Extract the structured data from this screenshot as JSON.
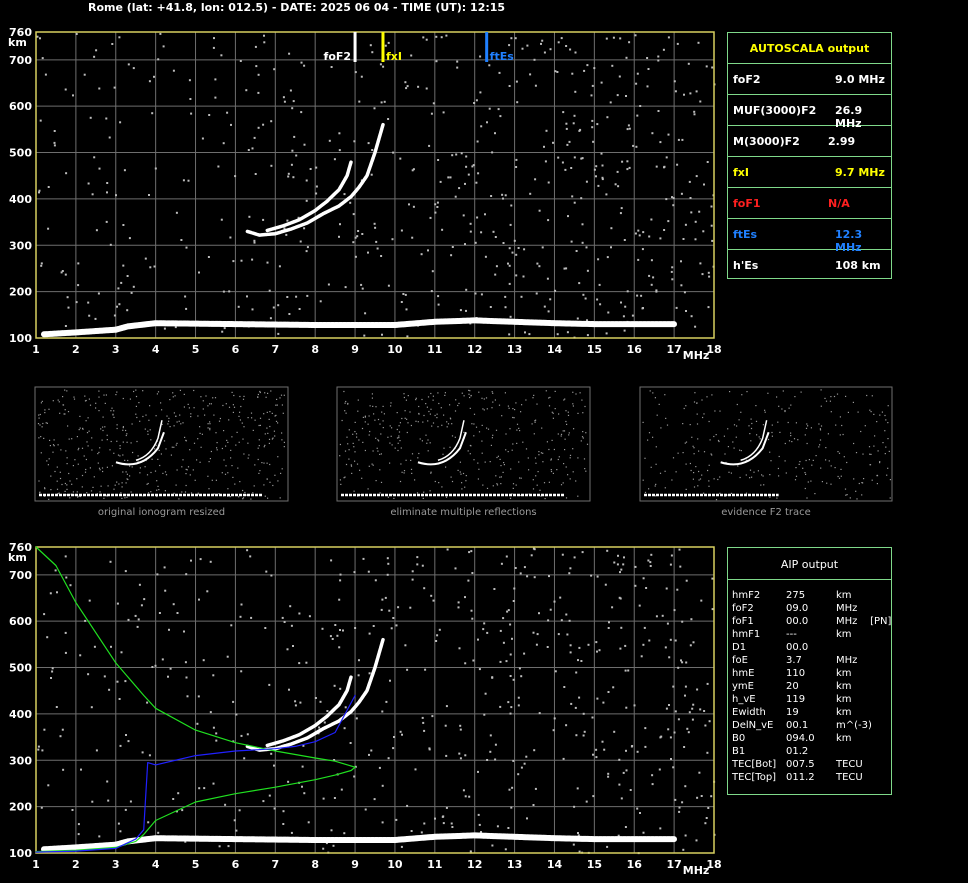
{
  "header": "Rome (lat: +41.8, lon: 012.5) - DATE: 2025 06 04 - TIME (UT): 12:15",
  "colors": {
    "grid": "#6e6e6e",
    "frame": "#d8d060",
    "green": "#7fd98a",
    "yellow": "#ffff00",
    "red": "#ff2020",
    "blue": "#2080ff",
    "trace": "#ffffff"
  },
  "chart_data": [
    {
      "type": "scatter",
      "title": "",
      "xlabel": "MHz",
      "ylabel": "km",
      "xlim": [
        1,
        18
      ],
      "ylim": [
        100,
        760
      ],
      "xticks": [
        "1",
        "2",
        "3",
        "4",
        "5",
        "6",
        "7",
        "8",
        "9",
        "10",
        "11",
        "12",
        "13",
        "14",
        "15",
        "16",
        "17",
        "18"
      ],
      "yticks": [
        "100",
        "200",
        "300",
        "400",
        "500",
        "600",
        "700",
        "760"
      ],
      "markers": [
        {
          "label": "foF2",
          "x": 9.0,
          "color": "#ffffff"
        },
        {
          "label": "fxI",
          "x": 9.7,
          "color": "#ffff00"
        },
        {
          "label": "ftEs",
          "x": 12.3,
          "color": "#2080ff"
        }
      ],
      "series": [
        {
          "x": [
            6.3,
            6.6,
            7.0,
            7.4,
            7.8,
            8.2,
            8.6,
            8.9,
            9.1,
            9.3,
            9.5,
            9.7
          ],
          "y": [
            330,
            322,
            325,
            335,
            348,
            368,
            385,
            405,
            425,
            450,
            500,
            560
          ]
        },
        {
          "x": [
            6.8,
            7.2,
            7.6,
            8.0,
            8.3,
            8.6,
            8.8,
            8.9
          ],
          "y": [
            332,
            342,
            355,
            375,
            395,
            420,
            450,
            480
          ]
        },
        {
          "x": [
            1.2,
            2.0,
            3.0,
            3.3,
            4.0,
            6.0,
            8.0,
            10.0,
            11.0,
            12.0,
            13.0,
            14.0,
            15.0,
            16.0,
            17.0
          ],
          "y": [
            108,
            112,
            118,
            125,
            132,
            130,
            128,
            128,
            135,
            138,
            135,
            132,
            130,
            130,
            130
          ]
        }
      ]
    },
    {
      "type": "line",
      "title": "",
      "xlabel": "MHz",
      "ylabel": "km",
      "xlim": [
        1,
        18
      ],
      "ylim": [
        100,
        760
      ],
      "xticks": [
        "1",
        "2",
        "3",
        "4",
        "5",
        "6",
        "7",
        "8",
        "9",
        "10",
        "11",
        "12",
        "13",
        "14",
        "15",
        "16",
        "17",
        "18"
      ],
      "yticks": [
        "100",
        "200",
        "300",
        "400",
        "500",
        "600",
        "700",
        "760"
      ],
      "series": [
        {
          "x": [
            6.3,
            6.6,
            7.0,
            7.4,
            7.8,
            8.2,
            8.6,
            8.9,
            9.1,
            9.3,
            9.5,
            9.7
          ],
          "y": [
            330,
            322,
            325,
            335,
            348,
            368,
            385,
            405,
            425,
            450,
            500,
            560
          ]
        },
        {
          "x": [
            6.8,
            7.2,
            7.6,
            8.0,
            8.3,
            8.6,
            8.8,
            8.9
          ],
          "y": [
            332,
            342,
            355,
            375,
            395,
            420,
            450,
            480
          ]
        },
        {
          "x": [
            1.2,
            2.0,
            3.0,
            3.3,
            4.0,
            6.0,
            8.0,
            10.0,
            11.0,
            12.0,
            13.0,
            14.0,
            15.0,
            16.0,
            17.0
          ],
          "y": [
            108,
            112,
            118,
            125,
            132,
            130,
            128,
            128,
            135,
            138,
            135,
            132,
            130,
            130,
            130
          ]
        },
        {
          "x": [
            1.0,
            1.5,
            2.0,
            3.0,
            3.7,
            4.0,
            5.0,
            6.0,
            7.0,
            8.0,
            8.5,
            9.0
          ],
          "y": [
            760,
            720,
            640,
            510,
            440,
            412,
            365,
            338,
            320,
            305,
            298,
            285
          ],
          "color": "#20e020"
        },
        {
          "x": [
            1.0,
            2.0,
            3.0,
            3.5,
            3.7,
            4.0,
            5.0,
            6.0,
            7.0,
            8.0,
            8.5,
            8.9,
            9.0
          ],
          "y": [
            103,
            106,
            112,
            125,
            140,
            170,
            210,
            228,
            242,
            258,
            268,
            278,
            285
          ],
          "color": "#20e020"
        },
        {
          "x": [
            1.0,
            2.0,
            3.0,
            3.5,
            3.7,
            3.8,
            4.0,
            5.0,
            6.0,
            7.0,
            7.5,
            8.0,
            8.5,
            9.0
          ],
          "y": [
            102,
            104,
            110,
            130,
            150,
            295,
            290,
            310,
            320,
            325,
            330,
            340,
            360,
            440
          ],
          "color": "#2020ff"
        }
      ]
    }
  ],
  "autoscala": {
    "title": "AUTOSCALA output",
    "rows": [
      {
        "label": "foF2",
        "value": "9.0 MHz",
        "color": "#ffffff"
      },
      {
        "label": "MUF(3000)F2",
        "value": "26.9 MHz",
        "color": "#ffffff"
      },
      {
        "label": "M(3000)F2",
        "value": "2.99",
        "color": "#ffffff"
      },
      {
        "label": "fxI",
        "value": "9.7 MHz",
        "color": "#ffff00"
      },
      {
        "label": "foF1",
        "value": "N/A",
        "color": "#ff2020"
      },
      {
        "label": "ftEs",
        "value": "12.3 MHz",
        "color": "#2080ff"
      },
      {
        "label": "h'Es",
        "value": "108    km",
        "color": "#ffffff"
      }
    ]
  },
  "thumbs": [
    {
      "caption": "original ionogram resized"
    },
    {
      "caption": "eliminate multiple reflections"
    },
    {
      "caption": "evidence F2 trace"
    }
  ],
  "aip": {
    "title": "AIP output",
    "rows": [
      {
        "name": "hmF2",
        "value": "275",
        "unit": "km"
      },
      {
        "name": "foF2",
        "value": "09.0",
        "unit": "MHz"
      },
      {
        "name": "foF1",
        "value": "00.0",
        "unit": "MHz    [PN]"
      },
      {
        "name": "hmF1",
        "value": "---",
        "unit": "km"
      },
      {
        "name": "D1",
        "value": "00.0",
        "unit": ""
      },
      {
        "name": "foE",
        "value": "3.7",
        "unit": "MHz"
      },
      {
        "name": "hmE",
        "value": "110",
        "unit": "km"
      },
      {
        "name": "ymE",
        "value": "20",
        "unit": "km"
      },
      {
        "name": "h_vE",
        "value": "119",
        "unit": "km"
      },
      {
        "name": "Ewidth",
        "value": "19",
        "unit": "km"
      },
      {
        "name": "DelN_vE",
        "value": "00.1",
        "unit": "m^(-3)"
      },
      {
        "name": "B0",
        "value": "094.0",
        "unit": "km"
      },
      {
        "name": "B1",
        "value": "01.2",
        "unit": ""
      },
      {
        "name": "TEC[Bot]",
        "value": "007.5",
        "unit": "TECU"
      },
      {
        "name": "TEC[Top]",
        "value": "011.2",
        "unit": "TECU"
      }
    ]
  }
}
